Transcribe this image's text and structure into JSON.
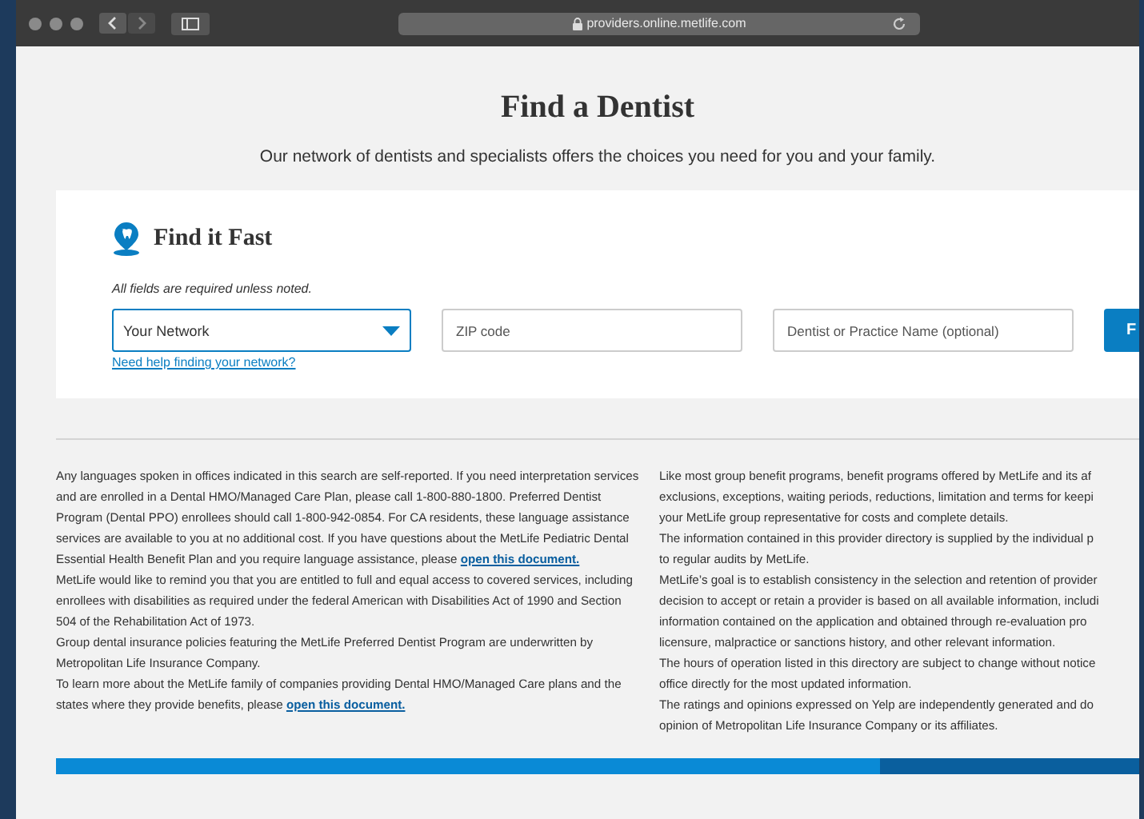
{
  "browser": {
    "url": "providers.online.metlife.com"
  },
  "page": {
    "title": "Find a Dentist",
    "subtitle": "Our network of dentists and specialists offers the choices you need for you and your family."
  },
  "search_card": {
    "title": "Find it Fast",
    "note": "All fields are required unless noted.",
    "network_select": {
      "value": "Your Network"
    },
    "help_link": "Need help finding your network?",
    "zip_field": {
      "placeholder": "ZIP code"
    },
    "name_field": {
      "placeholder": "Dentist or Practice Name (optional)"
    },
    "find_button": "F"
  },
  "disclaimers_left": [
    {
      "text": "Any languages spoken in offices indicated in this search are self-reported. If you need interpretation services and are enrolled in a Dental HMO/Managed Care Plan, please call 1-800-880-1800. Preferred Dentist Program (Dental PPO) enrollees should call 1-800-942-0854. For CA residents, these language assistance services are available to you at no additional cost. If you have questions about the MetLife Pediatric Dental Essential Health Benefit Plan and you require language assistance, please",
      "link": "open this document."
    },
    {
      "text": "MetLife would like to remind you that you are entitled to full and equal access to covered services, including enrollees with disabilities as required under the federal American with Disabilities Act of 1990 and Section 504 of the Rehabilitation Act of 1973."
    },
    {
      "text": "Group dental insurance policies featuring the MetLife Preferred Dentist Program are underwritten by Metropolitan Life Insurance Company."
    },
    {
      "text": "To learn more about the MetLife family of companies providing Dental HMO/Managed Care plans and the states where they provide benefits, please",
      "link": "open this document."
    }
  ],
  "disclaimers_right": [
    "Like most group benefit programs, benefit programs offered by MetLife and its af",
    "exclusions, exceptions, waiting periods, reductions, limitation and terms for keepi",
    "your MetLife group representative for costs and complete details.",
    "The information contained in this provider directory is supplied by the individual p",
    "to regular audits by MetLife.",
    "MetLife’s goal is to establish consistency in the selection and retention of provider",
    "decision to accept or retain a provider is based on all available information, includi",
    "information contained on the application and obtained through re-evaluation pro",
    "licensure, malpractice or sanctions history, and other relevant information.",
    "The hours of operation listed in this directory are subject to change without notice",
    "office directly for the most updated information.",
    "The ratings and opinions expressed on Yelp are independently generated and do",
    "opinion of Metropolitan Life Insurance Company or its affiliates."
  ]
}
